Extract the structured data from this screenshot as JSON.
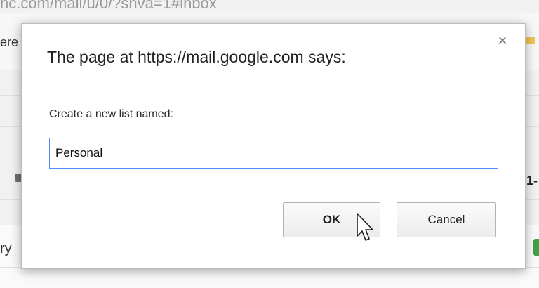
{
  "background": {
    "url_fragment": "nc.com/mail/u/0/?shva=1#inbox",
    "left_fragments": [
      "ere",
      "ry"
    ],
    "right_fragment": "1-"
  },
  "dialog": {
    "title": "The page at https://mail.google.com says:",
    "prompt_label": "Create a new list named:",
    "input_value": "Personal",
    "ok_label": "OK",
    "cancel_label": "Cancel",
    "close_glyph": "×"
  },
  "icons": {
    "close": "close-icon",
    "cursor": "mouse-pointer-icon"
  },
  "colors": {
    "focus_border": "#4d90fe"
  }
}
